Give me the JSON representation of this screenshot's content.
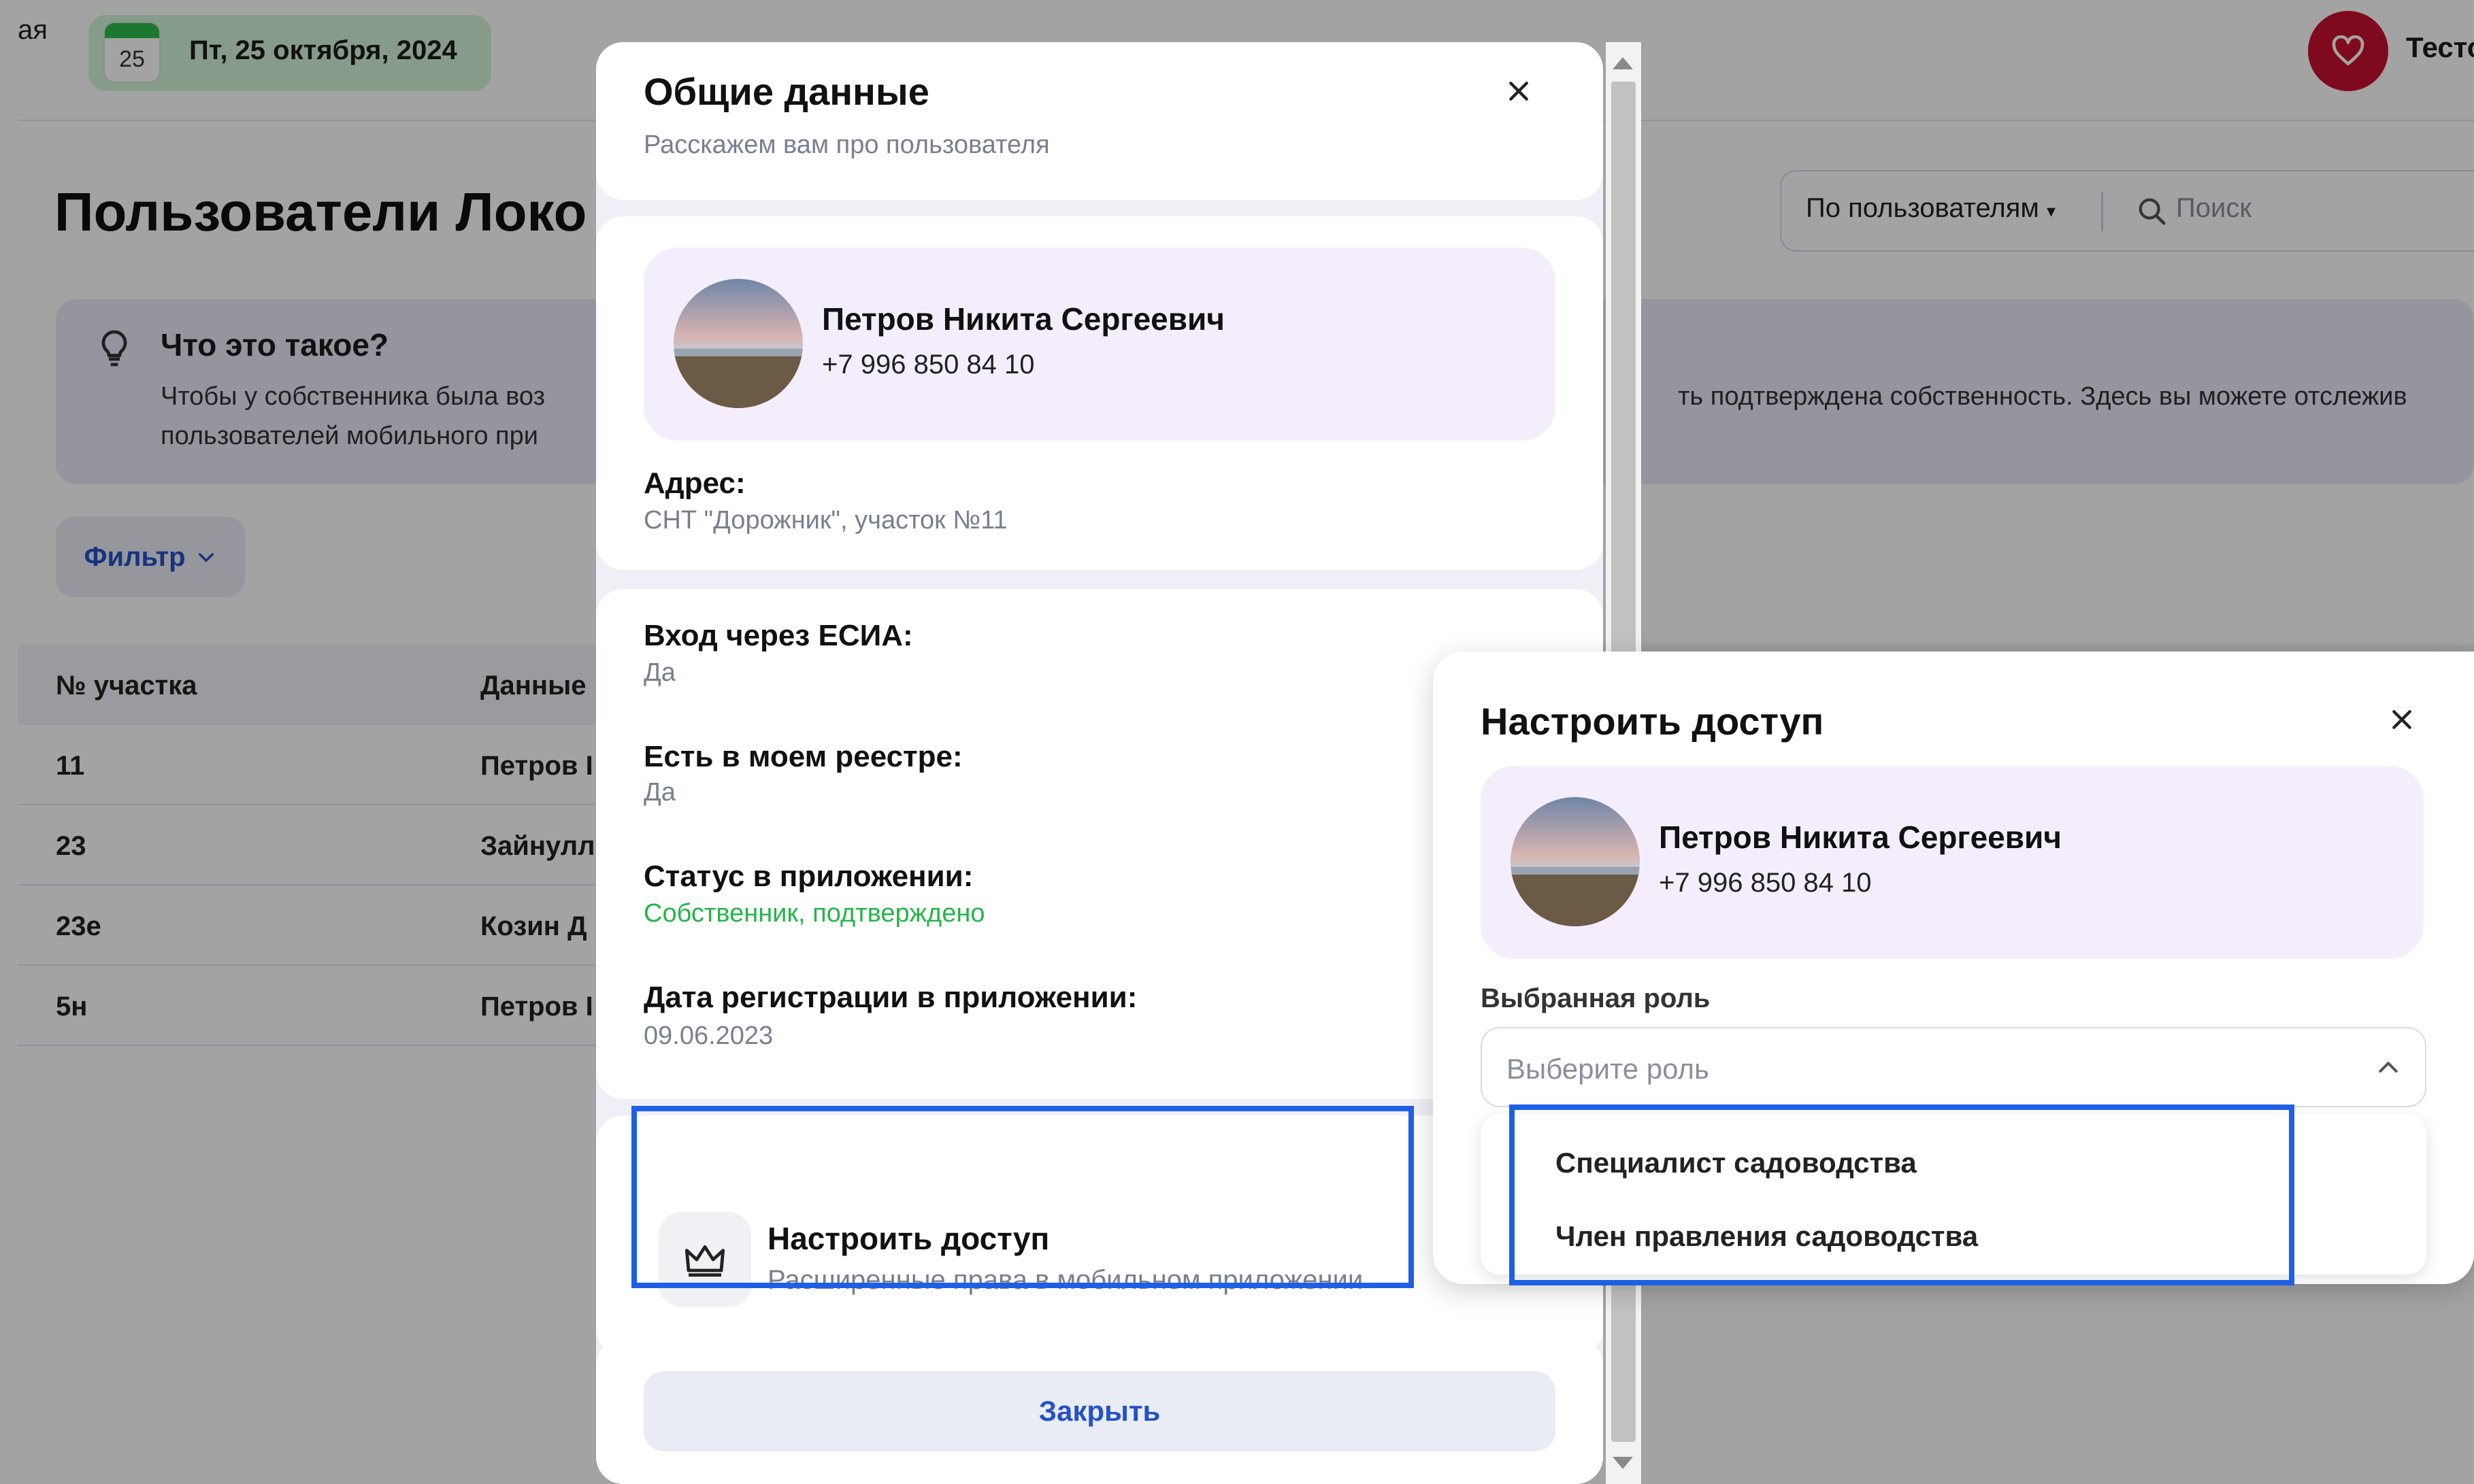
{
  "topbar": {
    "nav_cut_text": "ая",
    "calendar_day": "25",
    "date": "Пт, 25 октября, 2024",
    "user_name_cut": "Тесто"
  },
  "page": {
    "title": "Пользователи Локо",
    "search": {
      "mode": "По пользователям",
      "placeholder": "Поиск"
    },
    "info": {
      "title": "Что это такое?",
      "line1": "Чтобы у собственника была воз",
      "line1_cont": "ть подтверждена собственность. Здесь вы можете отслежив",
      "line2": "пользователей мобильного при"
    },
    "filter_label": "Фильтр",
    "table": {
      "headers": [
        "№ участка",
        "Данные"
      ],
      "rows": [
        [
          "11",
          "Петров I"
        ],
        [
          "23",
          "Зайнулл"
        ],
        [
          "23е",
          "Козин Д"
        ],
        [
          "5н",
          "Петров I"
        ]
      ]
    }
  },
  "modal_general": {
    "title": "Общие данные",
    "subtitle": "Расскажем вам про пользователя",
    "user": {
      "name": "Петров Никита Сергеевич",
      "phone": "+7 996 850 84 10"
    },
    "address_label": "Адрес:",
    "address_value": "СНТ \"Дорожник\", участок №11",
    "esia_label": "Вход через ЕСИА:",
    "esia_value": "Да",
    "registry_label": "Есть в моем реестре:",
    "registry_value": "Да",
    "status_label": "Статус в приложении:",
    "status_value": "Собственник, подтверждено",
    "regdate_label": "Дата регистрации в приложении:",
    "regdate_value": "09.06.2023",
    "access_title": "Настроить доступ",
    "access_subtitle": "Расширенные права в мобильном приложении",
    "close_button": "Закрыть"
  },
  "modal_access": {
    "title": "Настроить доступ",
    "user": {
      "name": "Петров Никита Сергеевич",
      "phone": "+7 996 850 84 10"
    },
    "role_label": "Выбранная роль",
    "role_placeholder": "Выберите роль",
    "role_options": [
      "Специалист садоводства",
      "Член правления садоводства"
    ]
  },
  "colors": {
    "accent_blue": "#2551c9",
    "highlight": "#1e5fe6",
    "status_green": "#25b44a",
    "heart_red": "#c8102e",
    "profile_bg": "#f4eefc"
  },
  "icons": [
    "calendar-icon",
    "heart-icon",
    "search-icon",
    "lightbulb-icon",
    "chevron-down-icon",
    "close-icon",
    "crown-icon",
    "chevron-up-icon"
  ]
}
